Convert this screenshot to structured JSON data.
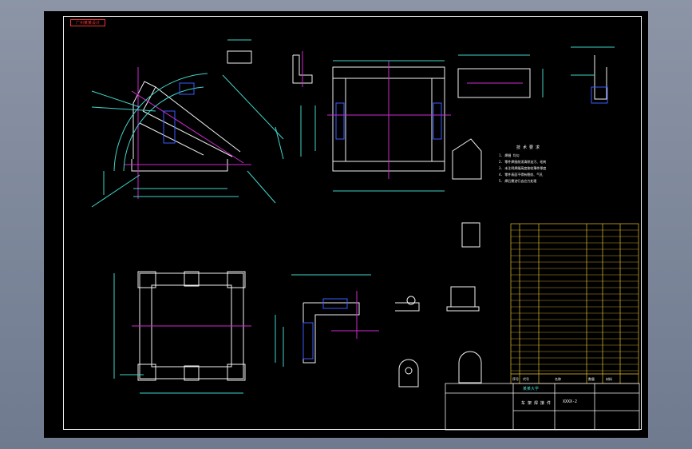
{
  "drawing": {
    "corner_tag": "广州某某设计",
    "colors": {
      "background": "#000000",
      "outline": "#f2f2f2",
      "dimension": "#3fd4c8",
      "centerline": "#d02ad0",
      "hidden": "#3a5cff",
      "note": "#ffffff",
      "table_line": "#e8c12e",
      "red": "#e03030"
    },
    "notes": {
      "title": "技 术 要 求",
      "lines": [
        "1. 焊缝 均匀",
        "2. 零件焊接前须清除油污、毛刺",
        "3. 未注明焊缝高度按较薄件厚度",
        "4. 零件表面不得有裂纹、气孔",
        "5. 焊后需进行去应力处理"
      ]
    },
    "bom_header": [
      "序号",
      "代号",
      "名称",
      "数量",
      "材料"
    ],
    "title_block": {
      "drawing_no": "XXXX-2",
      "school": "某某大学",
      "title": "车 架 焊 接 件"
    }
  }
}
